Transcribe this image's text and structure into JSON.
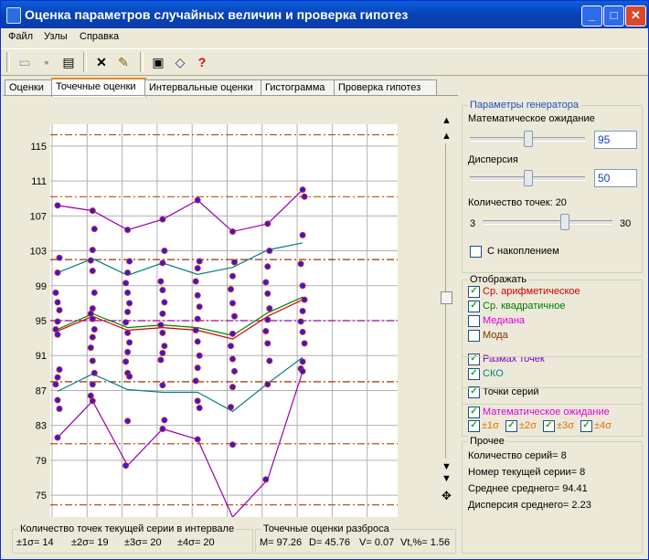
{
  "app": {
    "title": "Оценка параметров случайных величин и проверка гипотез"
  },
  "window_buttons": {
    "minimize": "_",
    "maximize": "□",
    "close": "✕"
  },
  "menu": [
    "Файл",
    "Узлы",
    "Справка"
  ],
  "toolbar": {
    "icons": [
      "open-folder-icon",
      "save-icon",
      "print-icon",
      "delete-icon",
      "report-icon",
      "camera-icon",
      "book-icon",
      "help-icon"
    ]
  },
  "tabs": [
    "Оценки",
    "Точечные оценки",
    "Интервальные оценки",
    "Гистограмма",
    "Проверка гипотез"
  ],
  "active_tab": 1,
  "chart_data": {
    "type": "scatter",
    "y_ticks": [
      "115",
      "111",
      "107",
      "103",
      "99",
      "95",
      "91",
      "87",
      "83",
      "79",
      "75"
    ],
    "ylim": [
      72.5,
      117.5
    ],
    "series_count": 8,
    "points": [
      [
        108.2,
        102.2,
        100.5,
        98.2,
        97.1,
        96.2,
        94.9,
        94.0,
        93.4,
        89.4,
        88.5,
        87.7,
        85.9,
        84.9,
        81.6
      ],
      [
        107.6,
        105.5,
        103.1,
        101.9,
        100.7,
        98.2,
        96.4,
        95.8,
        95.2,
        94.0,
        93.1,
        91.9,
        90.4,
        89.0,
        87.7,
        86.4,
        85.8
      ],
      [
        105.4,
        101.8,
        100.5,
        99.3,
        98.2,
        97.0,
        96.0,
        94.8,
        93.6,
        92.5,
        91.4,
        90.3,
        89.0,
        88.6,
        83.5,
        78.4
      ],
      [
        106.6,
        103.0,
        101.6,
        99.5,
        98.5,
        97.1,
        95.8,
        94.5,
        93.6,
        92.1,
        91.3,
        90.5,
        87.6,
        83.6,
        82.6
      ],
      [
        108.8,
        101.8,
        101.0,
        99.5,
        97.9,
        96.6,
        95.2,
        93.9,
        92.6,
        91.0,
        89.6,
        88.1,
        85.8,
        85.0,
        81.4
      ],
      [
        105.2,
        101.7,
        100.1,
        98.6,
        97.0,
        95.5,
        93.5,
        92.1,
        90.6,
        89.2,
        87.4,
        85.1,
        80.8
      ],
      [
        106.1,
        103.0,
        101.2,
        99.4,
        98.1,
        96.4,
        95.1,
        93.8,
        92.4,
        90.4,
        87.7,
        76.8
      ],
      [
        110.0,
        109.2,
        104.8,
        101.5,
        99.0,
        97.4,
        96.1,
        94.9,
        93.7,
        92.4,
        90.3,
        89.5,
        89.2
      ]
    ],
    "lines": {
      "mean": {
        "color": "#d00000",
        "values": [
          93.8,
          95.5,
          93.9,
          94.2,
          93.9,
          92.9,
          95.5,
          97.4
        ]
      },
      "rms": {
        "color": "#008000",
        "values": [
          94.0,
          95.8,
          94.2,
          94.5,
          94.2,
          93.3,
          95.9,
          97.7
        ]
      },
      "std": {
        "color": "#008080",
        "values": [
          100.5,
          102.1,
          100.2,
          101.6,
          100.3,
          101.1,
          103.1,
          103.9
        ],
        "values_low": [
          86.9,
          88.9,
          87.1,
          86.8,
          86.8,
          84.6,
          87.8,
          90.8
        ]
      },
      "range": {
        "color": "#9900aa",
        "values": [
          108.2,
          107.6,
          105.4,
          106.6,
          108.8,
          105.2,
          106.1,
          110.0
        ],
        "values_low": [
          81.6,
          85.8,
          78.4,
          82.6,
          81.4,
          72.5,
          76.8,
          89.2
        ]
      }
    },
    "h_lines": [
      {
        "y": 116.3,
        "color": "#c05010"
      },
      {
        "y": 109.2,
        "color": "#c05010"
      },
      {
        "y": 102.0,
        "color": "#a03000"
      },
      {
        "y": 95.0,
        "color": "#a000a0"
      },
      {
        "y": 88.0,
        "color": "#a03000"
      },
      {
        "y": 80.9,
        "color": "#c05010"
      },
      {
        "y": 73.9,
        "color": "#c05010"
      }
    ]
  },
  "generator": {
    "title": "Параметры генератора",
    "expectation_label": "Математическое ожидание",
    "expectation_value": "95",
    "expectation_level": 0.5,
    "variance_label": "Дисперсия",
    "variance_value": "50",
    "variance_level": 0.5,
    "points_label": "Количество точек: 20",
    "points_min": "3",
    "points_max": "30",
    "points_level": 0.63,
    "accumulate_label": "С накоплением",
    "accumulate_checked": false
  },
  "display": {
    "title": "Отображать",
    "items": [
      {
        "label": "Ср. арифметическое",
        "checked": true,
        "color": "#d00000"
      },
      {
        "label": "Ср. квадратичное",
        "checked": true,
        "color": "#008000"
      },
      {
        "label": "Медиана",
        "checked": false,
        "color": "#e000e0"
      },
      {
        "label": "Мода",
        "checked": false,
        "color": "#803000"
      },
      {
        "label": "Размах точек",
        "checked": true,
        "color": "#8000c0"
      },
      {
        "label": "СКО",
        "checked": true,
        "color": "#008080"
      },
      {
        "label": "Точки серий",
        "checked": true,
        "color": "#000000"
      },
      {
        "label": "Математическое ожидание",
        "checked": true,
        "color": "#e000e0"
      }
    ],
    "sigma": [
      {
        "label": "±1σ",
        "checked": true
      },
      {
        "label": "±2σ",
        "checked": true
      },
      {
        "label": "±3σ",
        "checked": true
      },
      {
        "label": "±4σ",
        "checked": true
      }
    ],
    "sigma_color": "#e07010"
  },
  "other": {
    "title": "Прочее",
    "lines": [
      "Количество серий= 8",
      "Номер текущей серии= 8",
      "Среднее среднего= 94.41",
      "Дисперсия среднего= 2.23"
    ]
  },
  "status_left": {
    "title": "Количество точек текущей серии в интервале",
    "s1": "±1σ= 14",
    "s2": "±2σ= 19",
    "s3": "±3σ= 20",
    "s4": "±4σ= 20"
  },
  "status_right": {
    "title": "Точечные оценки разброса",
    "m": "M= 97.26",
    "d": "D= 45.76",
    "v": "V= 0.07",
    "vt": "Vt,%= 1.56"
  }
}
